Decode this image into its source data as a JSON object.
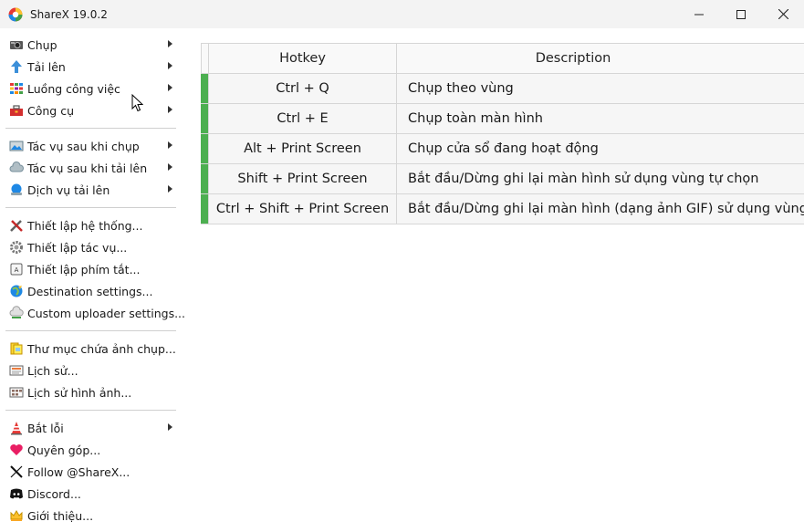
{
  "window": {
    "title": "ShareX 19.0.2"
  },
  "menu": {
    "groups": [
      [
        {
          "label": "Chụp",
          "icon": "camera-icon",
          "submenu": true
        },
        {
          "label": "Tải lên",
          "icon": "upload-arrow-icon",
          "submenu": true
        },
        {
          "label": "Luồng công việc",
          "icon": "workflow-grid-icon",
          "submenu": true
        },
        {
          "label": "Công cụ",
          "icon": "toolbox-icon",
          "submenu": true
        }
      ],
      [
        {
          "label": "Tác vụ sau khi chụp",
          "icon": "image-tasks-icon",
          "submenu": true
        },
        {
          "label": "Tác vụ sau khi tải lên",
          "icon": "cloud-tasks-icon",
          "submenu": true
        },
        {
          "label": "Dịch vụ tải lên",
          "icon": "upload-service-icon",
          "submenu": true
        }
      ],
      [
        {
          "label": "Thiết lập hệ thống...",
          "icon": "tools-icon",
          "submenu": false
        },
        {
          "label": "Thiết lập tác vụ...",
          "icon": "gear-icon",
          "submenu": false
        },
        {
          "label": "Thiết lập phím tắt...",
          "icon": "keyboard-icon",
          "submenu": false
        },
        {
          "label": "Destination settings...",
          "icon": "globe-icon",
          "submenu": false
        },
        {
          "label": "Custom uploader settings...",
          "icon": "cloud-settings-icon",
          "submenu": false
        }
      ],
      [
        {
          "label": "Thư mục chứa ảnh chụp...",
          "icon": "folder-icon",
          "submenu": false
        },
        {
          "label": "Lịch sử...",
          "icon": "history-icon",
          "submenu": false
        },
        {
          "label": "Lịch sử hình ảnh...",
          "icon": "image-history-icon",
          "submenu": false
        }
      ],
      [
        {
          "label": "Bắt lỗi",
          "icon": "bug-cone-icon",
          "submenu": true
        },
        {
          "label": "Quyên góp...",
          "icon": "heart-icon",
          "submenu": false
        },
        {
          "label": "Follow @ShareX...",
          "icon": "x-logo-icon",
          "submenu": false
        },
        {
          "label": "Discord...",
          "icon": "discord-icon",
          "submenu": false
        },
        {
          "label": "Giới thiệu...",
          "icon": "crown-icon",
          "submenu": false
        }
      ]
    ]
  },
  "hotkeys": {
    "columns": {
      "hotkey": "Hotkey",
      "description": "Description"
    },
    "rows": [
      {
        "hotkey": "Ctrl + Q",
        "description": "Chụp theo vùng"
      },
      {
        "hotkey": "Ctrl + E",
        "description": "Chụp toàn màn hình"
      },
      {
        "hotkey": "Alt + Print Screen",
        "description": "Chụp cửa sổ đang hoạt động"
      },
      {
        "hotkey": "Shift + Print Screen",
        "description": "Bắt đầu/Dừng ghi lại màn hình sử dụng vùng tự chọn"
      },
      {
        "hotkey": "Ctrl + Shift + Print Screen",
        "description": "Bắt đầu/Dừng ghi lại màn hình (dạng ảnh GIF) sử dụng vùng tự chọn"
      }
    ]
  },
  "colors": {
    "active_strip": "#4caf50",
    "titlebar": "#f3f3f3"
  }
}
